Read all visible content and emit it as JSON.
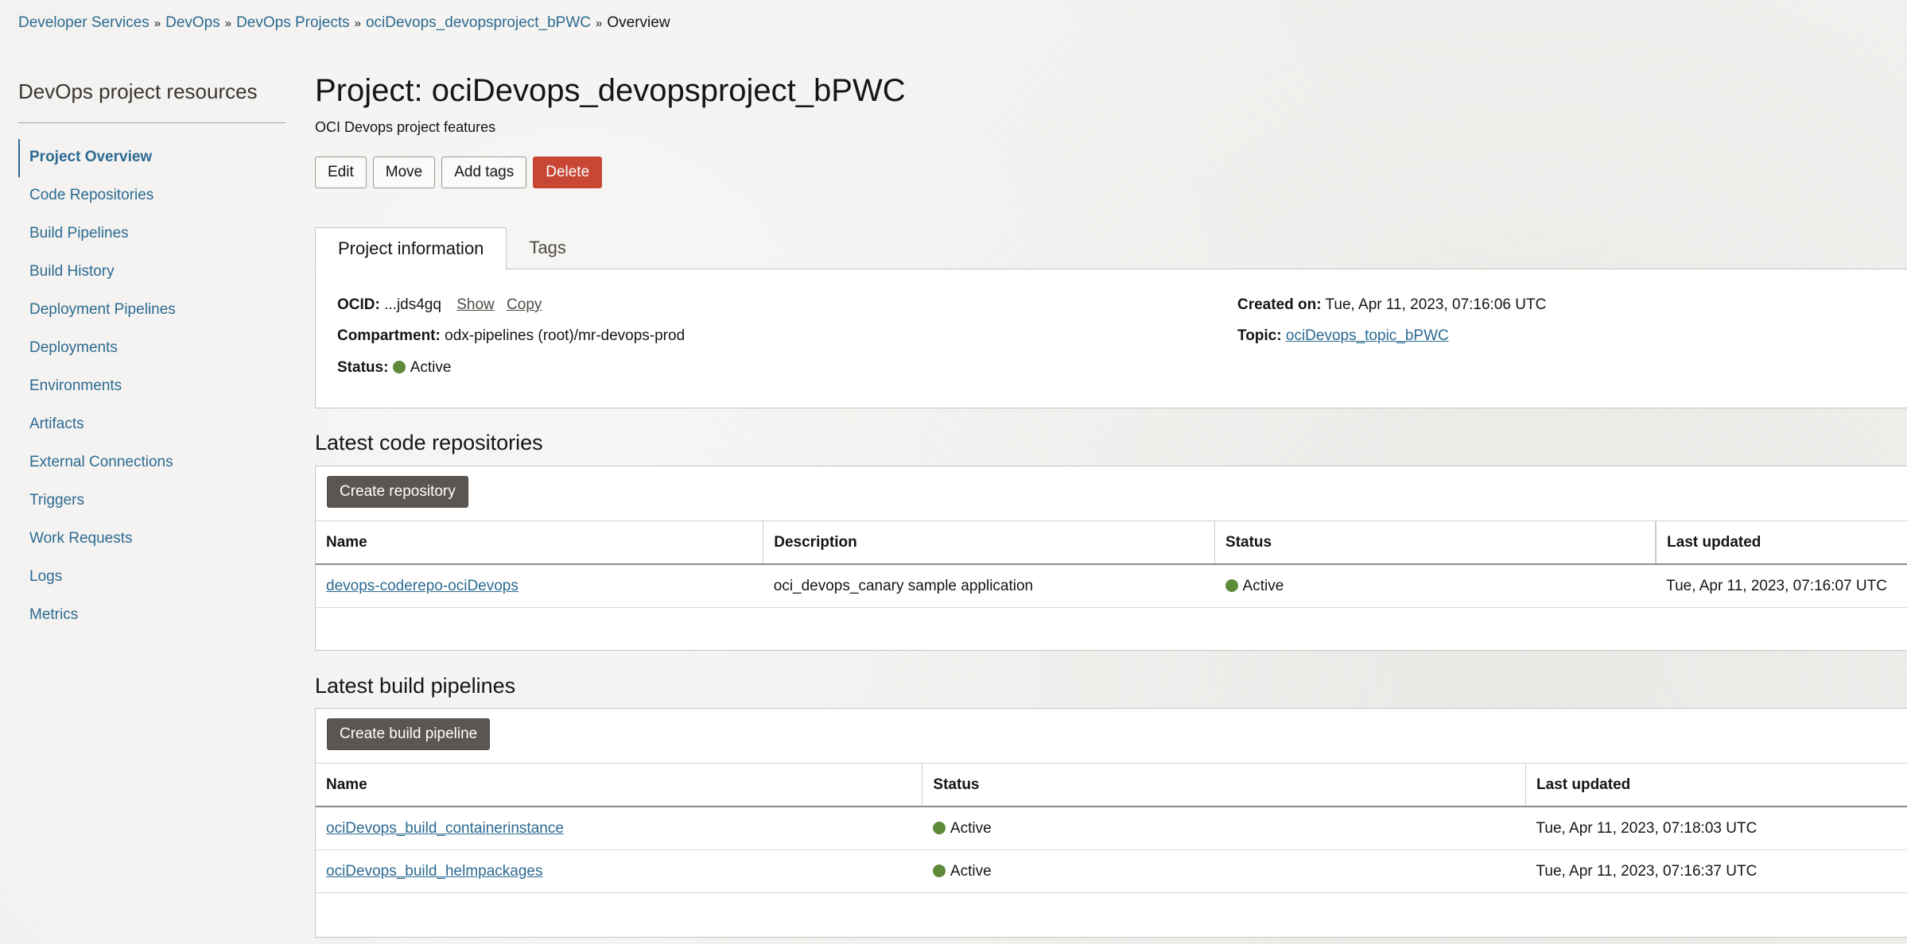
{
  "breadcrumb": {
    "items": [
      "Developer Services",
      "DevOps",
      "DevOps Projects",
      "ociDevops_devopsproject_bPWC"
    ],
    "separator": "»",
    "current": "Overview"
  },
  "sidebar": {
    "title": "DevOps project resources",
    "items": [
      {
        "label": "Project Overview"
      },
      {
        "label": "Code Repositories"
      },
      {
        "label": "Build Pipelines"
      },
      {
        "label": "Build History"
      },
      {
        "label": "Deployment Pipelines"
      },
      {
        "label": "Deployments"
      },
      {
        "label": "Environments"
      },
      {
        "label": "Artifacts"
      },
      {
        "label": "External Connections"
      },
      {
        "label": "Triggers"
      },
      {
        "label": "Work Requests"
      },
      {
        "label": "Logs"
      },
      {
        "label": "Metrics"
      }
    ]
  },
  "header": {
    "title": "Project: ociDevops_devopsproject_bPWC",
    "subtitle": "OCI Devops project features"
  },
  "actions": {
    "edit": "Edit",
    "move": "Move",
    "add_tags": "Add tags",
    "delete": "Delete"
  },
  "tabs": [
    {
      "label": "Project information"
    },
    {
      "label": "Tags"
    }
  ],
  "info": {
    "ocid_label": "OCID:",
    "ocid_value": "...jds4gq",
    "show": "Show",
    "copy": "Copy",
    "compartment_label": "Compartment:",
    "compartment_value": "odx-pipelines (root)/mr-devops-prod",
    "status_label": "Status:",
    "status_value": "Active",
    "created_label": "Created on:",
    "created_value": "Tue, Apr 11, 2023, 07:16:06 UTC",
    "topic_label": "Topic:",
    "topic_value": "ociDevops_topic_bPWC"
  },
  "repos": {
    "title": "Latest code repositories",
    "create_button": "Create repository",
    "columns": [
      "Name",
      "Description",
      "Status",
      "Last updated"
    ],
    "rows": [
      {
        "name": "devops-coderepo-ociDevops",
        "description": "oci_devops_canary sample application",
        "status": "Active",
        "updated": "Tue, Apr 11, 2023, 07:16:07 UTC"
      }
    ]
  },
  "pipelines": {
    "title": "Latest build pipelines",
    "create_button": "Create build pipeline",
    "columns": [
      "Name",
      "Status",
      "Last updated"
    ],
    "rows": [
      {
        "name": "ociDevops_build_containerinstance",
        "status": "Active",
        "updated": "Tue, Apr 11, 2023, 07:18:03 UTC"
      },
      {
        "name": "ociDevops_build_helmpackages",
        "status": "Active",
        "updated": "Tue, Apr 11, 2023, 07:16:37 UTC"
      }
    ]
  },
  "colors": {
    "link": "#2c6a91",
    "danger": "#c74634",
    "status_active": "#5e8a3a",
    "dark_button": "#5b5652"
  }
}
